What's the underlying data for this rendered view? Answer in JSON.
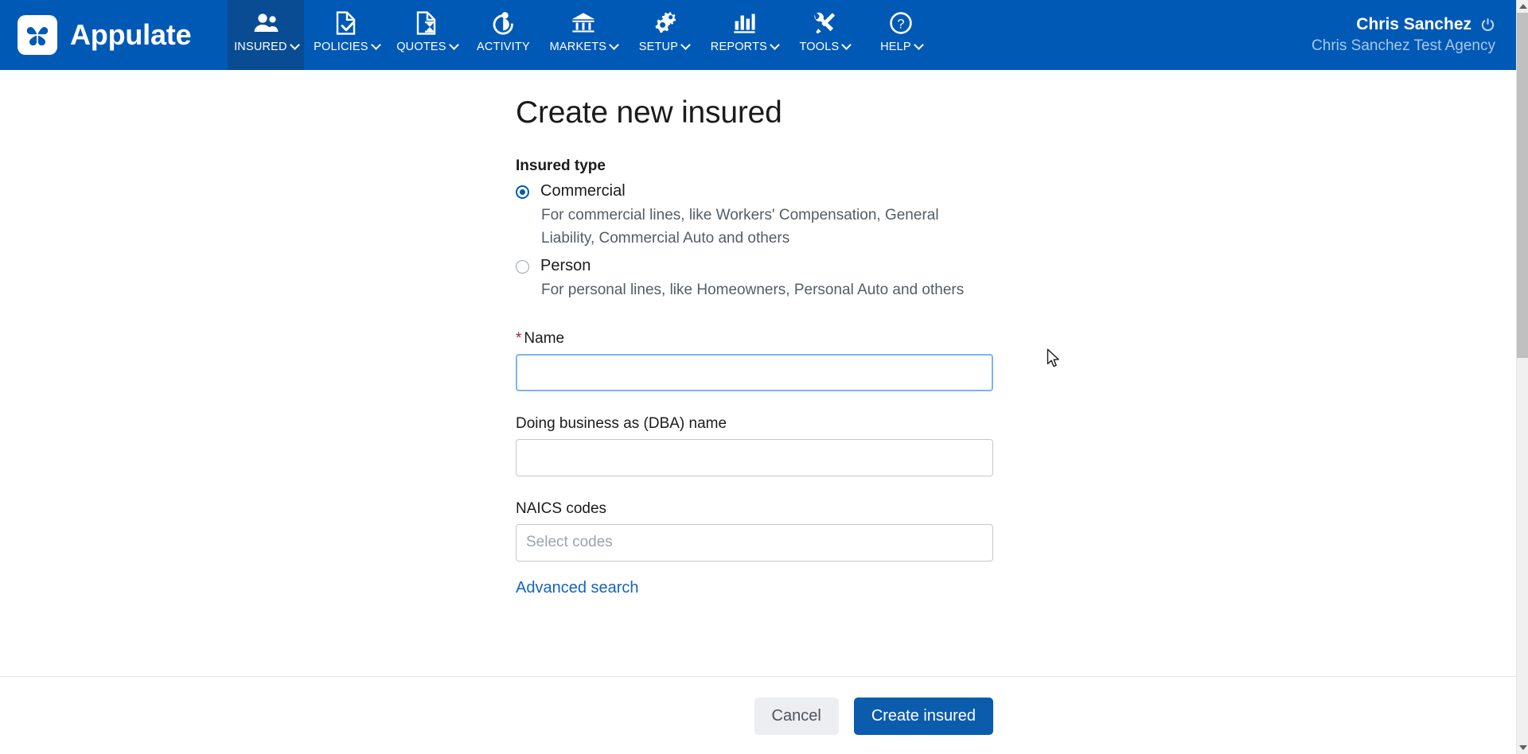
{
  "app": {
    "brand_name": "Appulate",
    "logo_icon": "clover-logo-icon",
    "header_bg": "#0159b6",
    "active_tab_bg": "#0a4c93",
    "accent": "#0b5cad",
    "link_color": "#1463c4",
    "required_color": "#b32121"
  },
  "nav": {
    "items": [
      {
        "id": "insured",
        "label": "INSURED",
        "icon": "users-icon",
        "has_caret": true,
        "active": true
      },
      {
        "id": "policies",
        "label": "POLICIES",
        "icon": "document-check-icon",
        "has_caret": true,
        "active": false
      },
      {
        "id": "quotes",
        "label": "QUOTES",
        "icon": "document-hourglass-icon",
        "has_caret": true,
        "active": false
      },
      {
        "id": "activity",
        "label": "ACTIVITY",
        "icon": "stopwatch-icon",
        "has_caret": false,
        "active": false
      },
      {
        "id": "markets",
        "label": "MARKETS",
        "icon": "bank-icon",
        "has_caret": true,
        "active": false
      },
      {
        "id": "setup",
        "label": "SETUP",
        "icon": "gears-icon",
        "has_caret": true,
        "active": false
      },
      {
        "id": "reports",
        "label": "REPORTS",
        "icon": "bar-chart-icon",
        "has_caret": true,
        "active": false
      },
      {
        "id": "tools",
        "label": "TOOLS",
        "icon": "wrench-screwdriver-icon",
        "has_caret": true,
        "active": false
      },
      {
        "id": "help",
        "label": "HELP",
        "icon": "question-circle-icon",
        "has_caret": true,
        "active": false
      }
    ]
  },
  "user": {
    "name": "Chris Sanchez",
    "agency": "Chris Sanchez Test Agency",
    "logout_icon": "power-icon"
  },
  "page": {
    "title": "Create new insured"
  },
  "form": {
    "insured_type": {
      "label": "Insured type",
      "selected": "commercial",
      "options": [
        {
          "id": "commercial",
          "label": "Commercial",
          "description": "For commercial lines, like Workers' Compensation, General Liability, Commercial Auto and others",
          "checked": true
        },
        {
          "id": "person",
          "label": "Person",
          "description": "For personal lines, like Homeowners, Personal Auto and others",
          "checked": false
        }
      ]
    },
    "name": {
      "label": "Name",
      "required_marker": "*",
      "value": "",
      "placeholder": "",
      "focused": true
    },
    "dba": {
      "label": "Doing business as (DBA) name",
      "value": "",
      "placeholder": ""
    },
    "naics": {
      "label": "NAICS codes",
      "value": "",
      "placeholder": "Select codes"
    },
    "advanced_search_link": "Advanced search"
  },
  "footer": {
    "cancel_label": "Cancel",
    "submit_label": "Create insured"
  },
  "scrollbar": {
    "up_arrow": "scroll-up-arrow-icon",
    "down_arrow": "scroll-down-arrow-icon"
  }
}
